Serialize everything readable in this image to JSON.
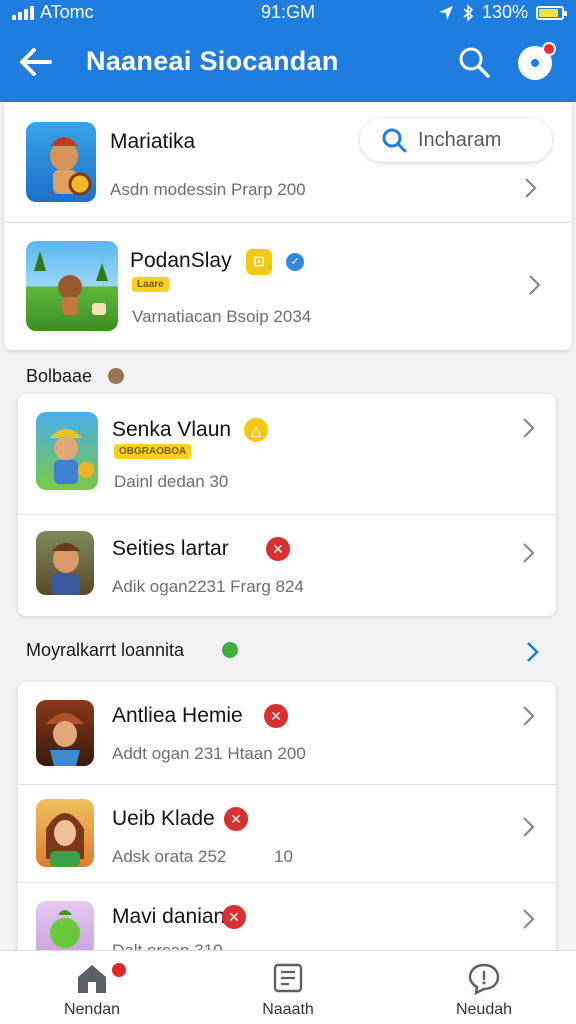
{
  "status": {
    "carrier": "ATomc",
    "time": "91:GM",
    "battery": "130%",
    "battery_level": 0.85
  },
  "header": {
    "title": "Naaneai  Siocandan",
    "back_icon": "back-arrow-icon",
    "search_icon": "search-icon",
    "profile_icon": "profile-icon"
  },
  "search": {
    "placeholder": "Incharam"
  },
  "top_card": [
    {
      "name": "Mariatika",
      "sub": "Asdn modessin Prarp 200"
    },
    {
      "name": "PodanSlay",
      "tag": "Laare",
      "sub": "Varnatiacan Bsoip 2034"
    }
  ],
  "section1": {
    "title": "Bolbaae"
  },
  "card2": [
    {
      "name": "Senka Vlaun",
      "tag": "OBGRAOBOA",
      "sub": "Dainl dedan 30"
    },
    {
      "name": "Seities lartar",
      "sub": "Adik ogan2231 Frarg 824"
    }
  ],
  "section2": {
    "title": "Moyralkarrt loannita"
  },
  "card3": [
    {
      "name": "Antliea Hemie",
      "sub": "Addt ogan 231 Htaan 200"
    },
    {
      "name": "Ueib Klade",
      "sub": "Adsk orata 252",
      "extra": "10"
    },
    {
      "name": "Mavi danian",
      "sub": "Dalt orcan 310"
    }
  ],
  "bottom_nav": [
    {
      "label": "Nendan",
      "icon": "home-icon"
    },
    {
      "label": "Naaath",
      "icon": "news-icon"
    },
    {
      "label": "Neudah",
      "icon": "chat-icon"
    }
  ],
  "colors": {
    "primary": "#1f7de0",
    "accent_yellow": "#f2c914",
    "badge_red": "#d93030"
  }
}
